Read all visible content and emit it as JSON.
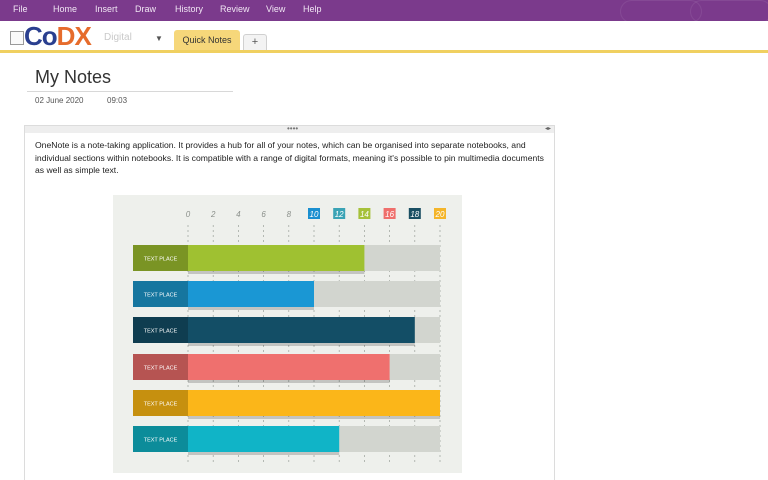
{
  "menu": [
    "File",
    "Home",
    "Insert",
    "Draw",
    "History",
    "Review",
    "View",
    "Help"
  ],
  "logo": {
    "part1": "Co",
    "part2": "DX"
  },
  "notebook": {
    "name": "Digital"
  },
  "tabs": {
    "quick_notes": "Quick Notes",
    "add": "+"
  },
  "page": {
    "title": "My Notes",
    "date": "02 June 2020",
    "time": "09:03",
    "body": "OneNote is a note-taking application. It provides a hub for all of your notes, which can be organised into separate notebooks, and individual sections within notebooks. It is compatible with a range of digital formats, meaning it's possible to pin multimedia documents as well as simple text."
  },
  "container": {
    "grip": "••••",
    "resize": "◂▸"
  },
  "chart_data": {
    "type": "bar",
    "orientation": "horizontal",
    "categories": [
      "TEXT PLACE",
      "TEXT PLACE",
      "TEXT PLACE",
      "TEXT PLACE",
      "TEXT PLACE",
      "TEXT PLACE"
    ],
    "values": [
      14,
      10,
      18,
      16,
      20,
      12
    ],
    "xlim": [
      0,
      20
    ],
    "ticks": [
      "0",
      "2",
      "4",
      "6",
      "8",
      "10",
      "12",
      "14",
      "16",
      "18",
      "20"
    ],
    "tick_badges": {
      "10": "#1a8fd0",
      "12": "#3aa3b5",
      "14": "#a6c13a",
      "16": "#ef6f6c",
      "18": "#1a4f63",
      "20": "#f4b52a"
    },
    "bar_colors": [
      "#9fc131",
      "#1a97d4",
      "#134e66",
      "#ef706e",
      "#fbb619",
      "#10b4c7"
    ],
    "label_colors": [
      "#7a9424",
      "#16769f",
      "#0f3d50",
      "#b65452",
      "#c6900f",
      "#0c8c9a"
    ],
    "track_color": "#d2d5cf",
    "grid": true
  }
}
